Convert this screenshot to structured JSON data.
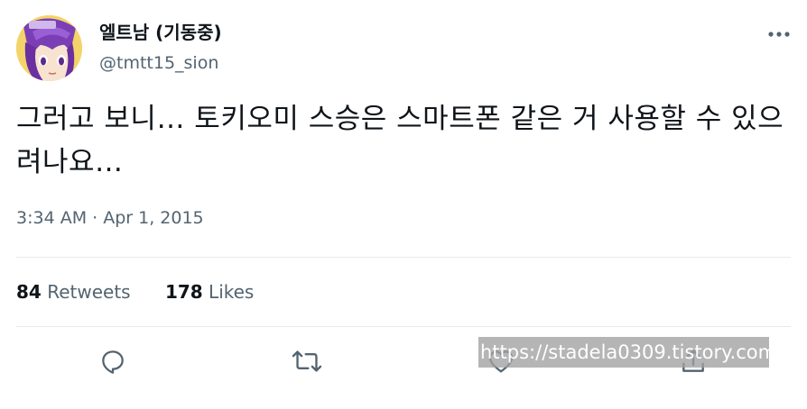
{
  "author": {
    "display_name": "엘트남 (기동중)",
    "handle": "@tmtt15_sion"
  },
  "tweet": {
    "text": "그러고 보니… 토키오미 스승은 스마트폰 같은 거 사용할 수 있으려나요…",
    "timestamp": "3:34 AM · Apr 1, 2015"
  },
  "stats": {
    "retweets_count": "84",
    "retweets_label": "Retweets",
    "likes_count": "178",
    "likes_label": "Likes"
  },
  "icons": {
    "more": "more-horizontal-icon",
    "reply": "reply-icon",
    "retweet": "retweet-icon",
    "like": "heart-icon",
    "share": "share-icon"
  },
  "colors": {
    "text": "#0f1419",
    "secondary": "#536471",
    "icon": "#536471",
    "divider": "#e6eaed",
    "watermark_bg": "#a0a0a0"
  },
  "watermark": {
    "text": "https://stadela0309.tistory.com"
  }
}
